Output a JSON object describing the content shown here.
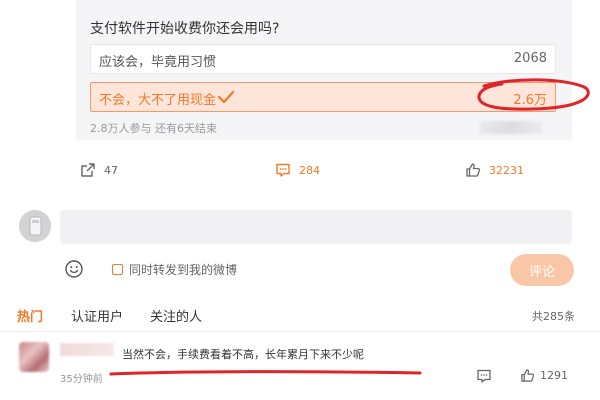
{
  "poll": {
    "question": "支付软件开始收费你还会用吗?",
    "options": [
      {
        "label": "应该会，毕竟用习惯",
        "count": "2068"
      },
      {
        "label": "不会，大不了用现金",
        "count": "2.6万",
        "selected": true
      }
    ],
    "meta": "2.8万人参与 还有6天结束"
  },
  "actions": {
    "share_count": "47",
    "comment_count": "284",
    "like_count": "32231"
  },
  "composer": {
    "repost_label": "同时转发到我的微博",
    "submit_label": "评论"
  },
  "tabs": [
    {
      "label": "热门",
      "active": true
    },
    {
      "label": "认证用户"
    },
    {
      "label": "关注的人"
    }
  ],
  "total_comments": "共285条",
  "comments": [
    {
      "text": "当然不会，手续费看着不高，长年累月下来不少呢",
      "time": "35分钟前",
      "likes": "1291"
    }
  ],
  "colors": {
    "accent": "#f5792a",
    "selected_bg": "#fde5d9",
    "annotation_red": "#e0252a",
    "button_disabled": "#f9c7a8"
  }
}
